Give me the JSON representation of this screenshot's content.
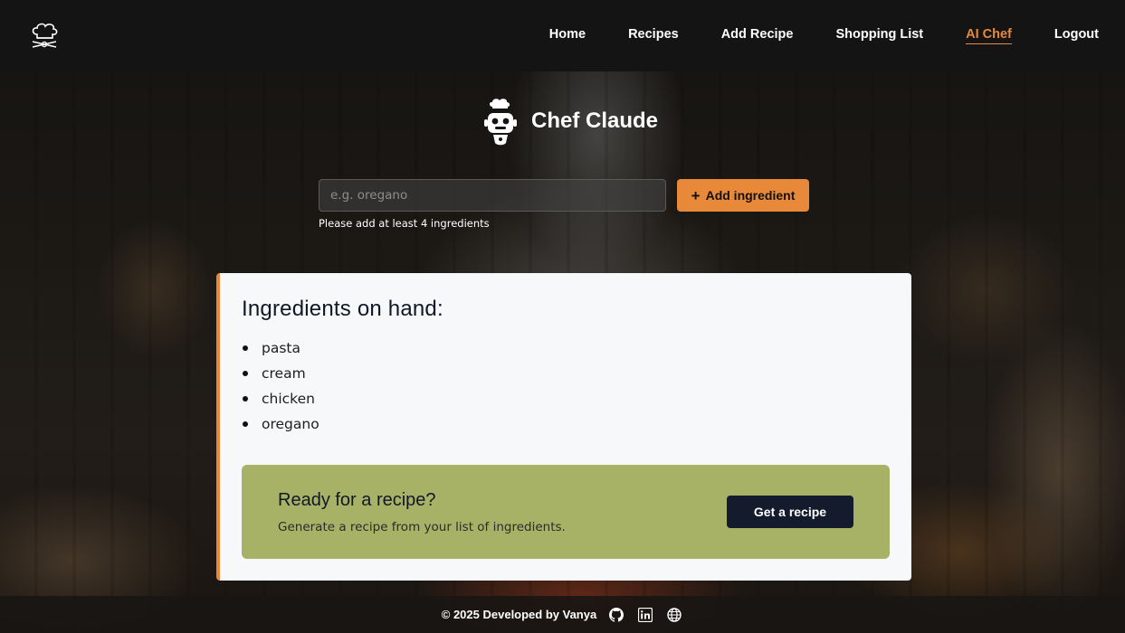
{
  "header": {
    "logo_icon": "chef-hat-logo-icon",
    "nav": [
      {
        "label": "Home"
      },
      {
        "label": "Recipes"
      },
      {
        "label": "Add Recipe"
      },
      {
        "label": "Shopping List"
      },
      {
        "label": "AI Chef",
        "active": true
      },
      {
        "label": "Logout"
      }
    ]
  },
  "hero": {
    "title": "Chef Claude",
    "icon": "robot-chef-icon"
  },
  "form": {
    "placeholder": "e.g. oregano",
    "value": "",
    "add_button_label": "Add ingredient",
    "hint": "Please add at least 4 ingredients"
  },
  "ingredients": {
    "heading": "Ingredients on hand:",
    "items": [
      "pasta",
      "cream",
      "chicken",
      "oregano"
    ]
  },
  "cta": {
    "title": "Ready for a recipe?",
    "subtitle": "Generate a recipe from your list of ingredients.",
    "button_label": "Get a recipe"
  },
  "footer": {
    "text": "© 2025 Developed by Vanya",
    "icons": [
      "github-icon",
      "linkedin-icon",
      "globe-icon"
    ]
  },
  "colors": {
    "accent": "#e8893a",
    "cta_background": "#a7b266",
    "dark_button": "#141b2d",
    "header_background": "#141414"
  }
}
